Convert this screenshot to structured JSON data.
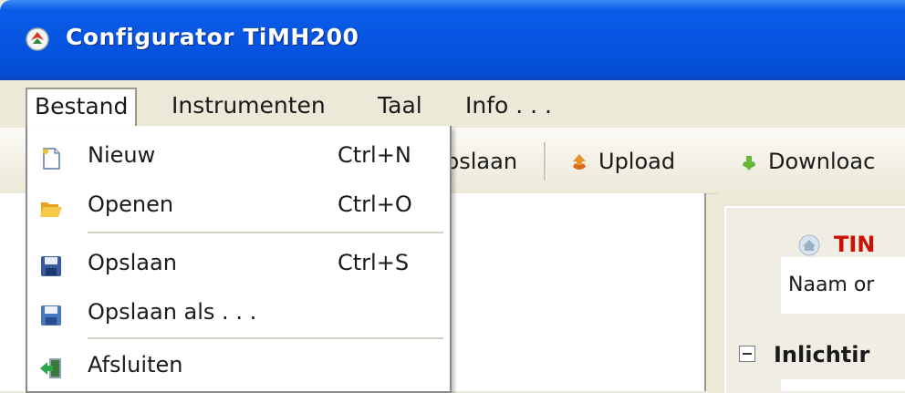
{
  "window": {
    "title": "Configurator TiMH200"
  },
  "menubar": {
    "items": [
      {
        "label": "Bestand"
      },
      {
        "label": "Instrumenten"
      },
      {
        "label": "Taal"
      },
      {
        "label": "Info . . ."
      }
    ]
  },
  "toolbar": {
    "save_partial": "pslaan",
    "upload": "Upload",
    "download_partial": "Downloac"
  },
  "dropdown": {
    "items": [
      {
        "label": "Nieuw",
        "shortcut": "Ctrl+N",
        "icon": "new-file-icon"
      },
      {
        "label": "Openen",
        "shortcut": "Ctrl+O",
        "icon": "open-folder-icon"
      },
      {
        "label": "Opslaan",
        "shortcut": "Ctrl+S",
        "icon": "save-icon"
      },
      {
        "label": "Opslaan als . . .",
        "shortcut": "",
        "icon": "save-as-icon"
      },
      {
        "label": "Afsluiten",
        "shortcut": "",
        "icon": "exit-icon"
      }
    ]
  },
  "right_panel": {
    "header_partial": "TIN",
    "name_field_partial": "Naam or",
    "section_partial": "Inlichtir"
  },
  "colors": {
    "titlebar": "#0655e2",
    "header_text": "#cc1100",
    "menu_bg": "#ece9d8"
  }
}
